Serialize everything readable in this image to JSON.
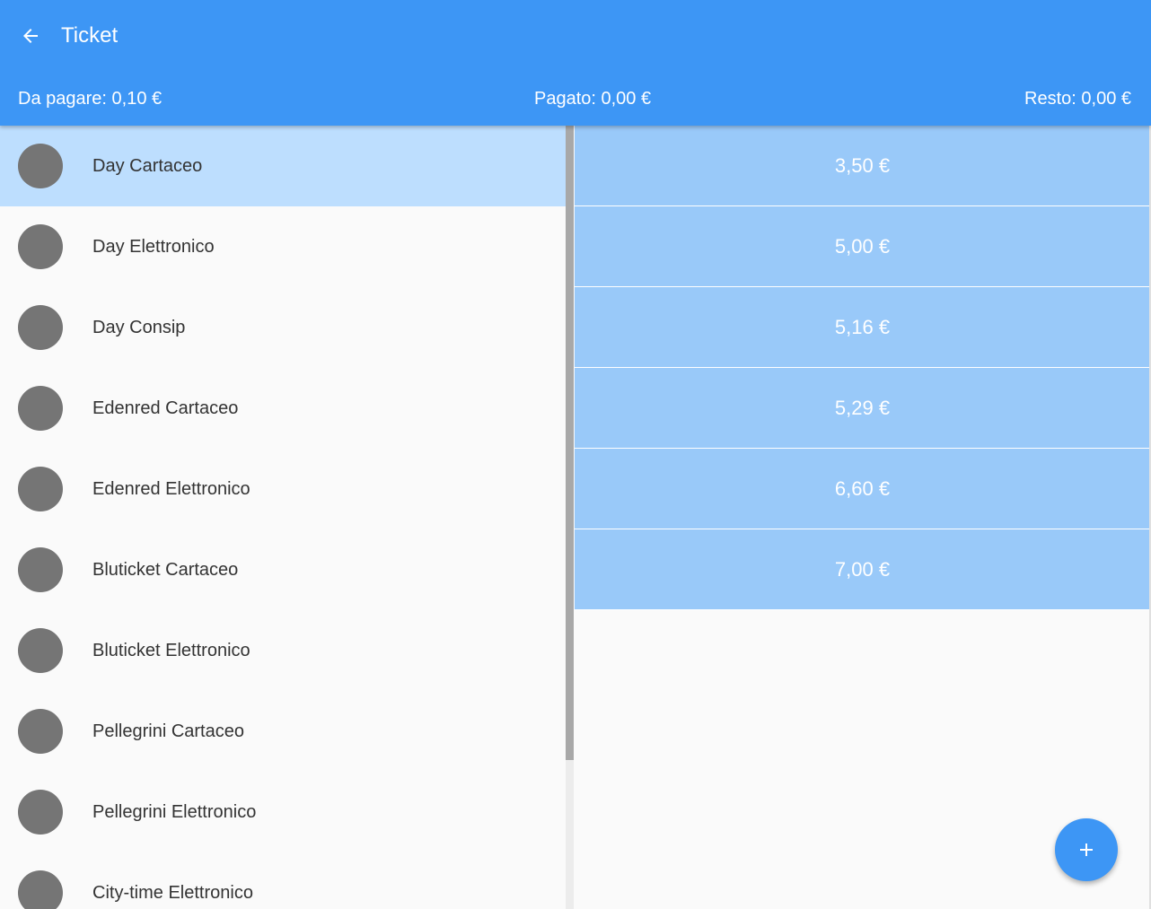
{
  "header": {
    "title": "Ticket",
    "back_icon": "arrow-left-icon",
    "due": "Da pagare: 0,10 €",
    "paid": "Pagato: 0,00 €",
    "change": "Resto: 0,00 €",
    "color": "#3d96f5"
  },
  "ticket_types": [
    {
      "label": "Day Cartaceo",
      "selected": true
    },
    {
      "label": "Day Elettronico",
      "selected": false
    },
    {
      "label": "Day Consip",
      "selected": false
    },
    {
      "label": "Edenred Cartaceo",
      "selected": false
    },
    {
      "label": "Edenred Elettronico",
      "selected": false
    },
    {
      "label": "Bluticket Cartaceo",
      "selected": false
    },
    {
      "label": "Bluticket Elettronico",
      "selected": false
    },
    {
      "label": "Pellegrini Cartaceo",
      "selected": false
    },
    {
      "label": "Pellegrini Elettronico",
      "selected": false
    },
    {
      "label": "City-time Elettronico",
      "selected": false
    }
  ],
  "values": [
    "3,50 €",
    "5,00 €",
    "5,16 €",
    "5,29 €",
    "6,60 €",
    "7,00 €"
  ],
  "fab": {
    "icon": "plus-icon"
  }
}
